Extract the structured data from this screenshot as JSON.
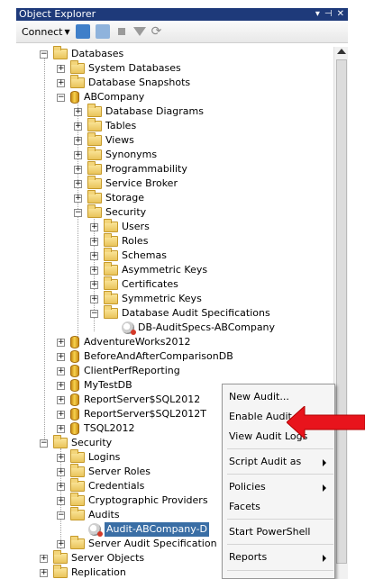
{
  "window": {
    "title": "Object Explorer",
    "controls": [
      "▾",
      "⊣",
      "✕"
    ]
  },
  "toolbar": {
    "connect_label": "Connect",
    "icons": [
      "connect-db-icon",
      "disconnect-icon",
      "stop-icon",
      "filter-icon",
      "refresh-icon"
    ]
  },
  "tree": {
    "databases": "Databases",
    "system_databases": "System Databases",
    "database_snapshots": "Database Snapshots",
    "abcompany": "ABCompany",
    "database_diagrams": "Database Diagrams",
    "tables": "Tables",
    "views": "Views",
    "synonyms": "Synonyms",
    "programmability": "Programmability",
    "service_broker": "Service Broker",
    "storage": "Storage",
    "security_db": "Security",
    "users": "Users",
    "roles": "Roles",
    "schemas": "Schemas",
    "asymmetric_keys": "Asymmetric Keys",
    "certificates": "Certificates",
    "symmetric_keys": "Symmetric Keys",
    "db_audit_specs": "Database Audit Specifications",
    "db_audit_spec_item": "DB-AuditSpecs-ABCompany",
    "adventureworks": "AdventureWorks2012",
    "beforeafter": "BeforeAndAfterComparisonDB",
    "clientperf": "ClientPerfReporting",
    "mytestdb": "MyTestDB",
    "reportserver": "ReportServer$SQL2012",
    "reportserver_t": "ReportServer$SQL2012T",
    "tsql2012": "TSQL2012",
    "security_server": "Security",
    "logins": "Logins",
    "server_roles": "Server Roles",
    "credentials": "Credentials",
    "crypto_providers": "Cryptographic Providers",
    "audits": "Audits",
    "audit_item": "Audit-ABCompany-D",
    "server_audit_specs": "Server Audit Specification",
    "server_objects": "Server Objects",
    "replication": "Replication"
  },
  "context_menu": {
    "new_audit": "New Audit...",
    "enable_audit": "Enable Audit",
    "view_audit_logs": "View Audit Logs",
    "script_audit_as": "Script Audit as",
    "policies": "Policies",
    "facets": "Facets",
    "start_powershell": "Start PowerShell",
    "reports": "Reports"
  },
  "colors": {
    "title_bar": "#1e3a7a",
    "selection": "#3a6ea5",
    "annotation_arrow": "#e8141c"
  }
}
